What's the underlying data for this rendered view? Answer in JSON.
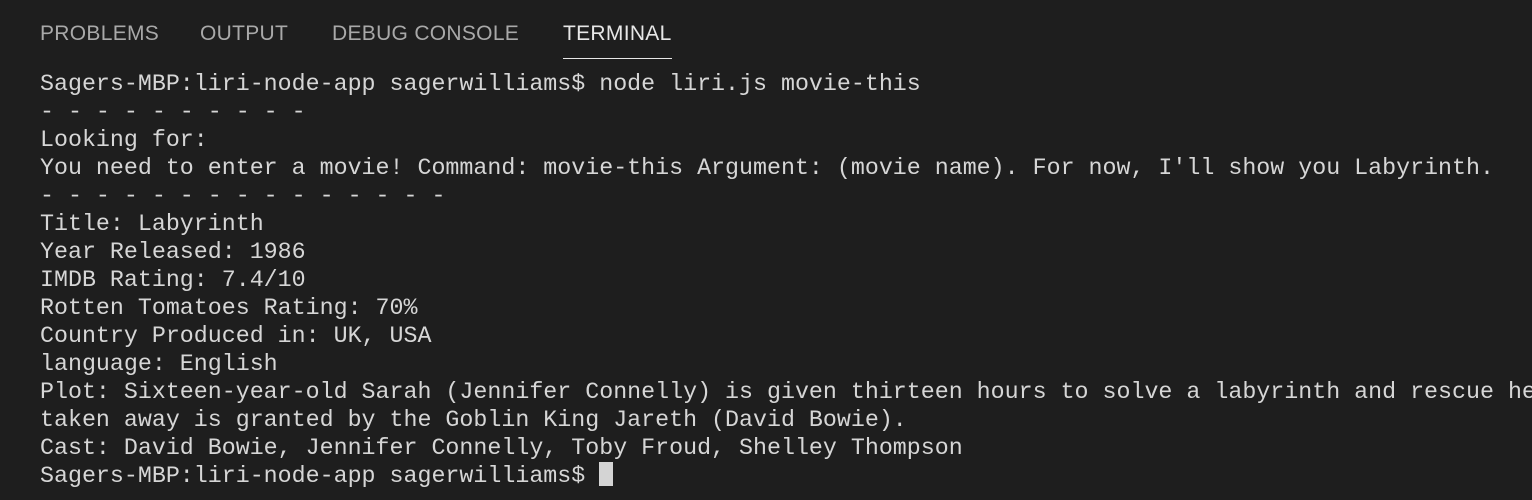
{
  "panel_tabs": [
    {
      "label": "PROBLEMS"
    },
    {
      "label": "OUTPUT"
    },
    {
      "label": "DEBUG CONSOLE"
    },
    {
      "label": "TERMINAL"
    }
  ],
  "active_tab": "TERMINAL",
  "terminal": {
    "lines": [
      "Sagers-MBP:liri-node-app sagerwilliams$ node liri.js movie-this",
      "- - - - - - - - - - ",
      "Looking for:",
      "You need to enter a movie! Command: movie-this Argument: (movie name). For now, I'll show you Labyrinth.",
      "- - - - - - - - - - - - - - - ",
      "Title: Labyrinth",
      "Year Released: 1986",
      "IMDB Rating: 7.4/10",
      "Rotten Tomatoes Rating: 70%",
      "Country Produced in: UK, USA",
      "language: English",
      "Plot: Sixteen-year-old Sarah (Jennifer Connelly) is given thirteen hours to solve a labyrinth and rescue he",
      "taken away is granted by the Goblin King Jareth (David Bowie).",
      "Cast: David Bowie, Jennifer Connelly, Toby Froud, Shelley Thompson"
    ],
    "prompt": "Sagers-MBP:liri-node-app sagerwilliams$"
  },
  "colors": {
    "background": "#1e1e1e",
    "text": "#d6d6d6",
    "tab_inactive": "#a9a9a9",
    "tab_active": "#e7e7e7"
  }
}
